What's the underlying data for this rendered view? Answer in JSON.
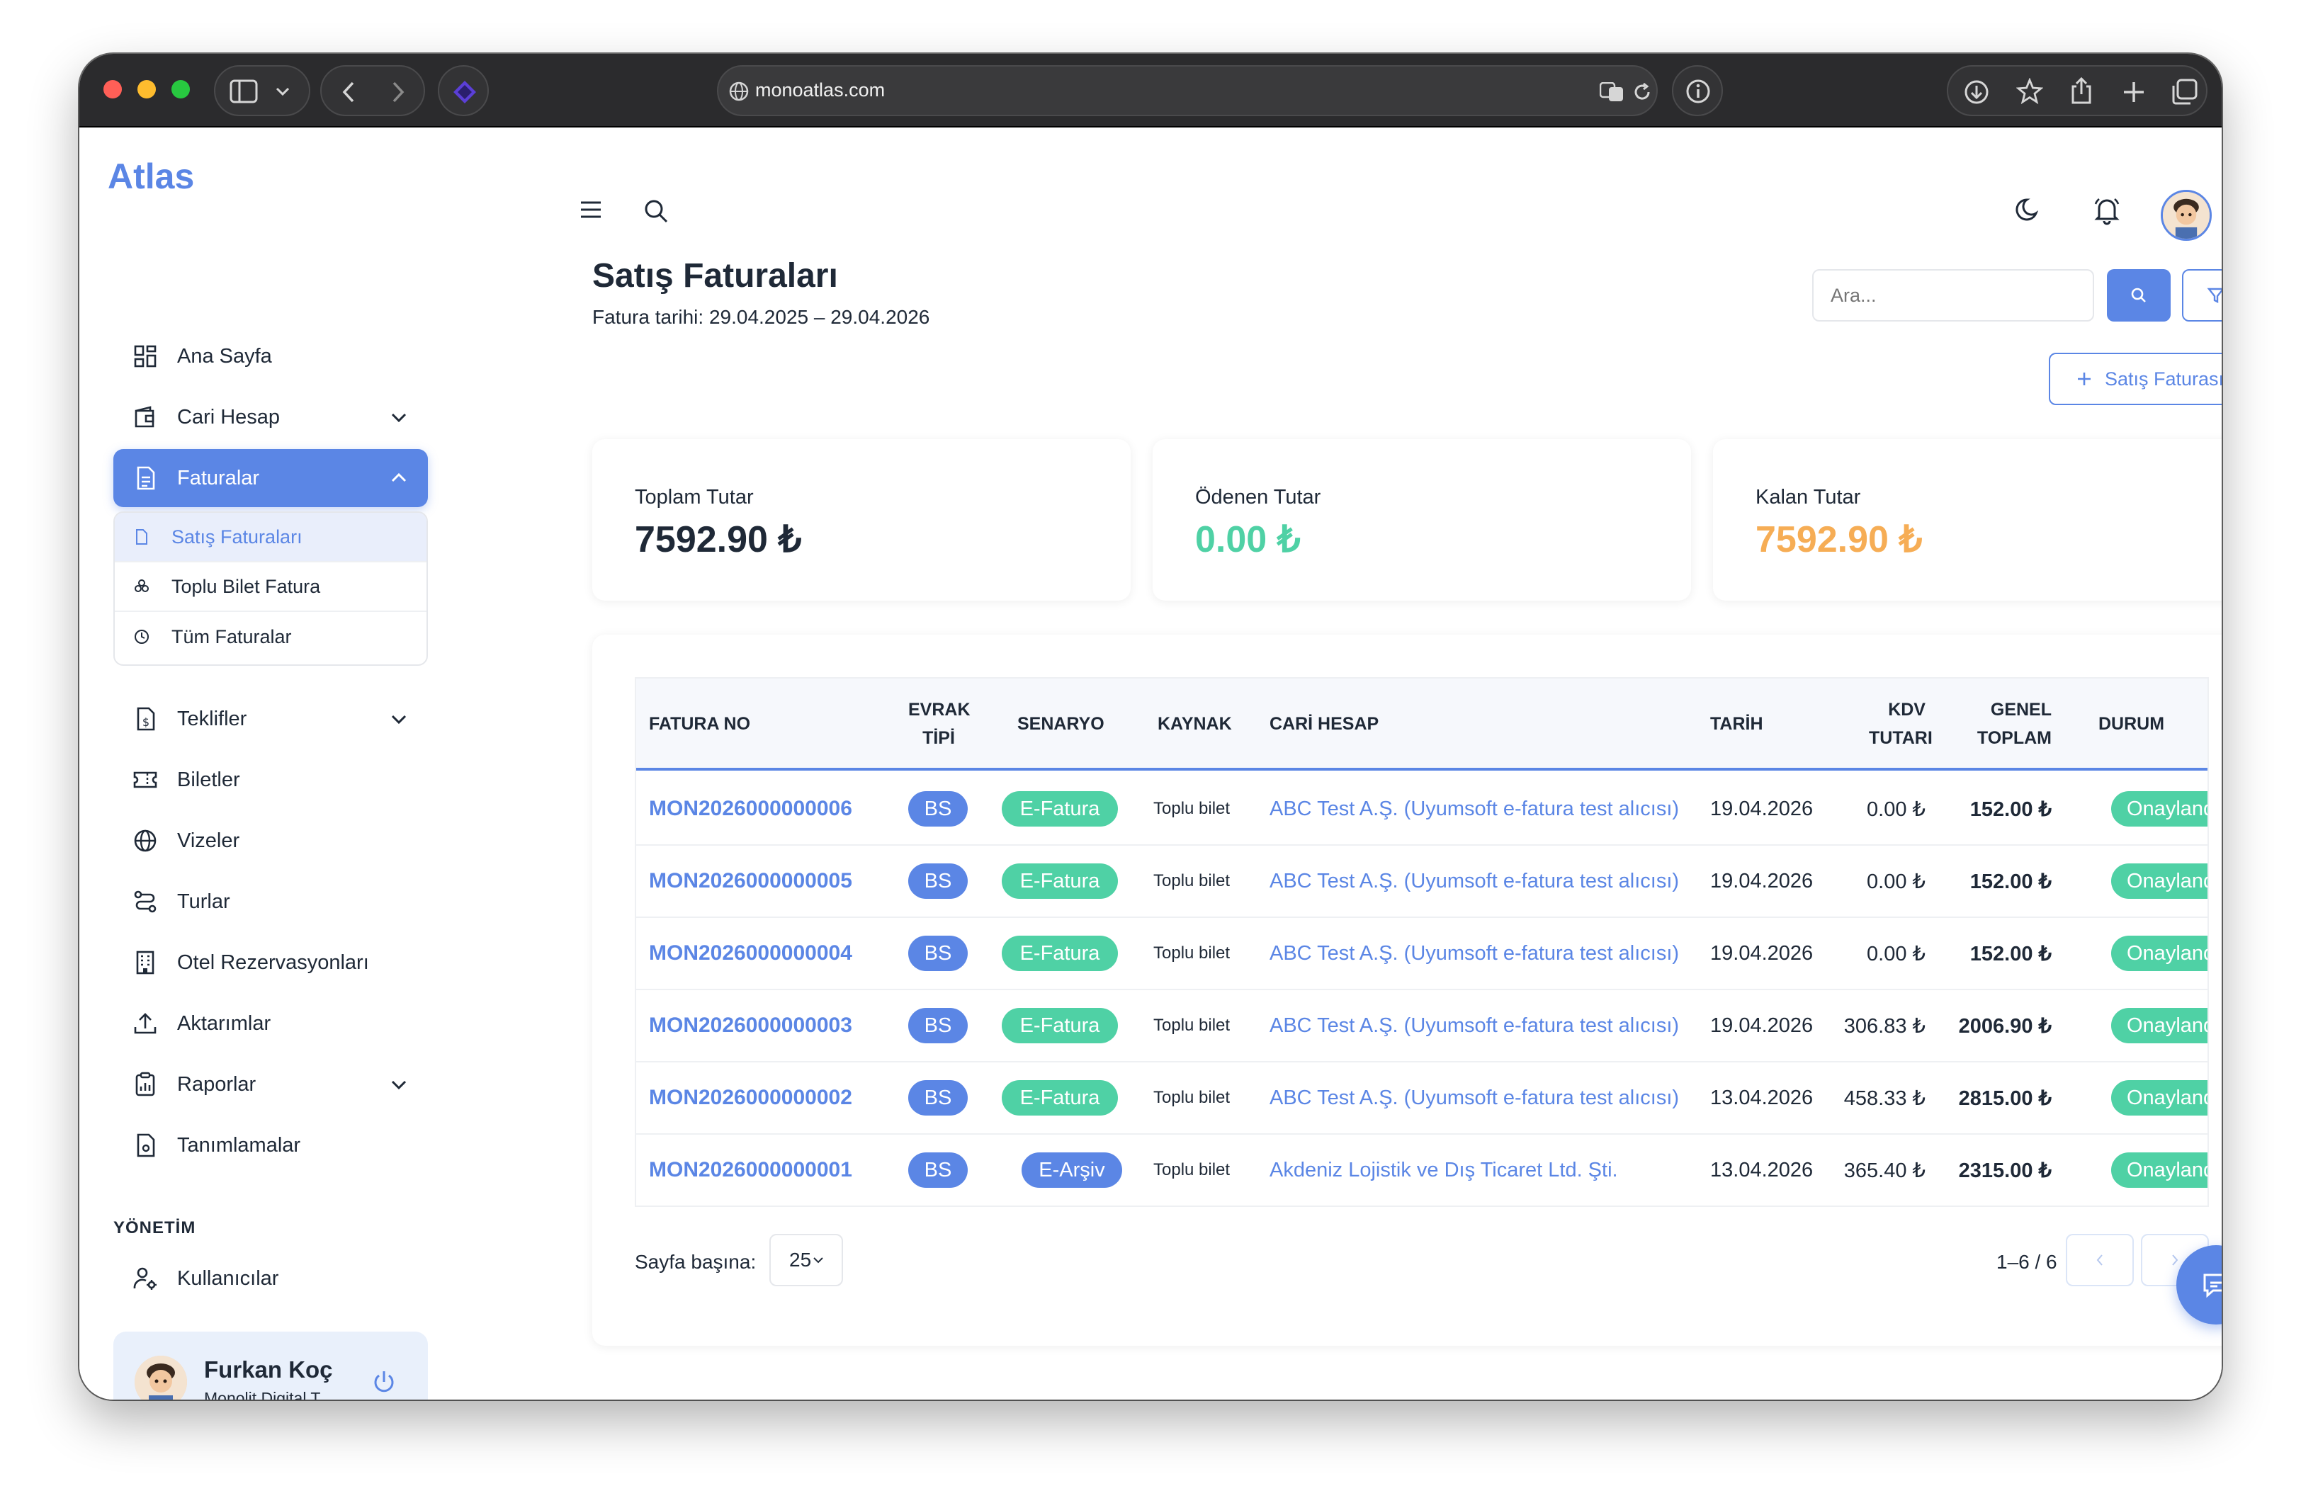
{
  "browser": {
    "url": "monoatlas.com"
  },
  "app": {
    "brand": "Atlas"
  },
  "sidebar": {
    "items": [
      {
        "label": "Ana Sayfa"
      },
      {
        "label": "Cari Hesap"
      },
      {
        "label": "Faturalar"
      },
      {
        "label": "Teklifler"
      },
      {
        "label": "Biletler"
      },
      {
        "label": "Vizeler"
      },
      {
        "label": "Turlar"
      },
      {
        "label": "Otel Rezervasyonları"
      },
      {
        "label": "Aktarımlar"
      },
      {
        "label": "Raporlar"
      },
      {
        "label": "Tanımlamalar"
      }
    ],
    "sub": [
      {
        "label": "Satış Faturaları"
      },
      {
        "label": "Toplu Bilet Fatura"
      },
      {
        "label": "Tüm Faturalar"
      }
    ],
    "section": "YÖNETİM",
    "admin": [
      {
        "label": "Kullanıcılar"
      }
    ],
    "user": {
      "name": "Furkan Koç",
      "company": "Monolit Digital T..."
    }
  },
  "page": {
    "title": "Satış Faturaları",
    "date_range": "Fatura tarihi: 29.04.2025 – 29.04.2026",
    "search_placeholder": "Ara...",
    "new_button": "Satış Faturası"
  },
  "summary": [
    {
      "label": "Toplam Tutar",
      "value": "7592.90 ₺",
      "color": "#1f2937"
    },
    {
      "label": "Ödenen Tutar",
      "value": "0.00 ₺",
      "color": "#4fd1a5"
    },
    {
      "label": "Kalan Tutar",
      "value": "7592.90 ₺",
      "color": "#f6ad55"
    }
  ],
  "table": {
    "headers": {
      "no": "FATURA NO",
      "tip1": "EVRAK",
      "tip2": "TİPİ",
      "senaryo": "SENARYO",
      "kaynak": "KAYNAK",
      "cari": "CARİ HESAP",
      "tarih": "TARİH",
      "kdv1": "KDV",
      "kdv2": "TUTARI",
      "gen1": "GENEL",
      "gen2": "TOPLAM",
      "durum": "DURUM"
    },
    "rows": [
      {
        "no": "MON2026000000006",
        "tip": "BS",
        "senaryo": "E-Fatura",
        "kaynak": "Toplu bilet",
        "cari": "ABC Test A.Ş. (Uyumsoft e-fatura test alıcısı)",
        "tarih": "19.04.2026",
        "kdv": "0.00 ₺",
        "toplam": "152.00 ₺",
        "durum": "Onaylandı"
      },
      {
        "no": "MON2026000000005",
        "tip": "BS",
        "senaryo": "E-Fatura",
        "kaynak": "Toplu bilet",
        "cari": "ABC Test A.Ş. (Uyumsoft e-fatura test alıcısı)",
        "tarih": "19.04.2026",
        "kdv": "0.00 ₺",
        "toplam": "152.00 ₺",
        "durum": "Onaylandı"
      },
      {
        "no": "MON2026000000004",
        "tip": "BS",
        "senaryo": "E-Fatura",
        "kaynak": "Toplu bilet",
        "cari": "ABC Test A.Ş. (Uyumsoft e-fatura test alıcısı)",
        "tarih": "19.04.2026",
        "kdv": "0.00 ₺",
        "toplam": "152.00 ₺",
        "durum": "Onaylandı"
      },
      {
        "no": "MON2026000000003",
        "tip": "BS",
        "senaryo": "E-Fatura",
        "kaynak": "Toplu bilet",
        "cari": "ABC Test A.Ş. (Uyumsoft e-fatura test alıcısı)",
        "tarih": "19.04.2026",
        "kdv": "306.83 ₺",
        "toplam": "2006.90 ₺",
        "durum": "Onaylandı"
      },
      {
        "no": "MON2026000000002",
        "tip": "BS",
        "senaryo": "E-Fatura",
        "kaynak": "Toplu bilet",
        "cari": "ABC Test A.Ş. (Uyumsoft e-fatura test alıcısı)",
        "tarih": "13.04.2026",
        "kdv": "458.33 ₺",
        "toplam": "2815.00 ₺",
        "durum": "Onaylandı"
      },
      {
        "no": "MON2026000000001",
        "tip": "BS",
        "senaryo": "E-Arşiv",
        "kaynak": "Toplu bilet",
        "cari": "Akdeniz Lojistik ve Dış Ticaret Ltd. Şti.",
        "tarih": "13.04.2026",
        "kdv": "365.40 ₺",
        "toplam": "2315.00 ₺",
        "durum": "Onaylandı"
      }
    ],
    "colors": {
      "efatura": "#4fd1a5",
      "earsiv": "#5b86e5"
    }
  },
  "pagination": {
    "per_page_label": "Sayfa başına:",
    "per_page": "25",
    "range": "1–6 / 6"
  }
}
